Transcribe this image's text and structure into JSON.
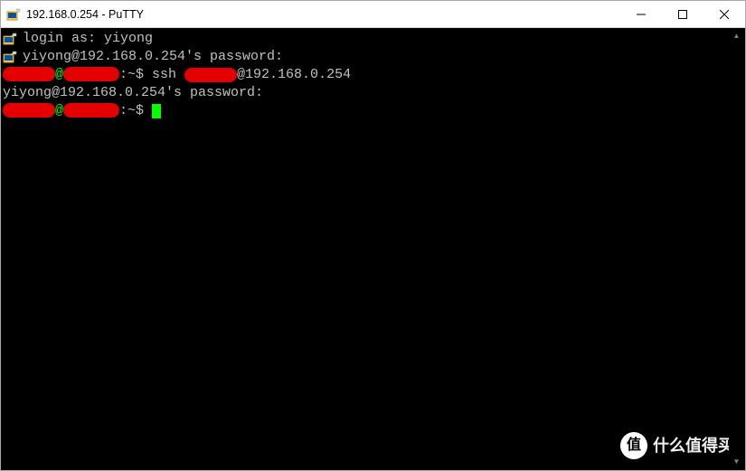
{
  "window": {
    "title": "192.168.0.254 - PuTTY"
  },
  "controls": {
    "minimize": "—",
    "maximize": "□",
    "close": "✕"
  },
  "terminal": {
    "line1_login_as": "login as: ",
    "line1_user": "yiyong",
    "line2": "yiyong@192.168.0.254's password:",
    "line3_at": "@",
    "line3_prompt": ":~$ ",
    "line3_cmd": "ssh ",
    "line3_tail": "@192.168.0.254",
    "line4": "yiyong@192.168.0.254's password:",
    "line5_at": "@",
    "line5_prompt": ":~$ "
  },
  "watermark": {
    "circle": "值",
    "text": "什么值得买"
  }
}
